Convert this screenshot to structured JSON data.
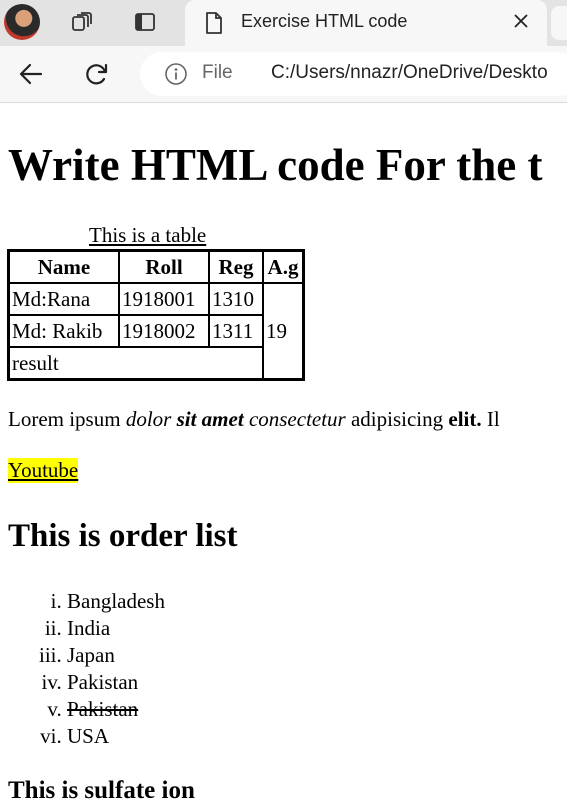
{
  "browser": {
    "tab_title": "Exercise HTML code",
    "address_label": "File",
    "address_url": "C:/Users/nnazr/OneDrive/Deskto",
    "icons": [
      "avatar",
      "workspaces-icon",
      "tab-actions-icon",
      "file-icon",
      "close-icon",
      "back-arrow-icon",
      "refresh-icon",
      "info-icon"
    ]
  },
  "page": {
    "heading": "Write HTML code For the t",
    "table": {
      "caption": "This is a table",
      "headers": [
        "Name",
        "Roll",
        "Reg",
        "A.g"
      ],
      "rows": [
        [
          "Md:Rana",
          "1918001",
          "1310"
        ],
        [
          "Md: Rakib",
          "1918002",
          "1311"
        ]
      ],
      "age": "19",
      "footer": "result"
    },
    "paragraph": {
      "t1": "Lorem ipsum ",
      "t2": "dolor ",
      "t3": "sit amet",
      "t4": " consectetur",
      "t5": " adipisicing ",
      "t6": "elit.",
      "t7": " Il"
    },
    "link": "Youtube",
    "link_highlight": "#ffff00",
    "list_heading": "This is order list",
    "list_items": [
      "Bangladesh",
      "India",
      "Japan",
      "Pakistan",
      "Pakistan",
      "USA"
    ],
    "next_heading": "This is sulfate ion"
  }
}
